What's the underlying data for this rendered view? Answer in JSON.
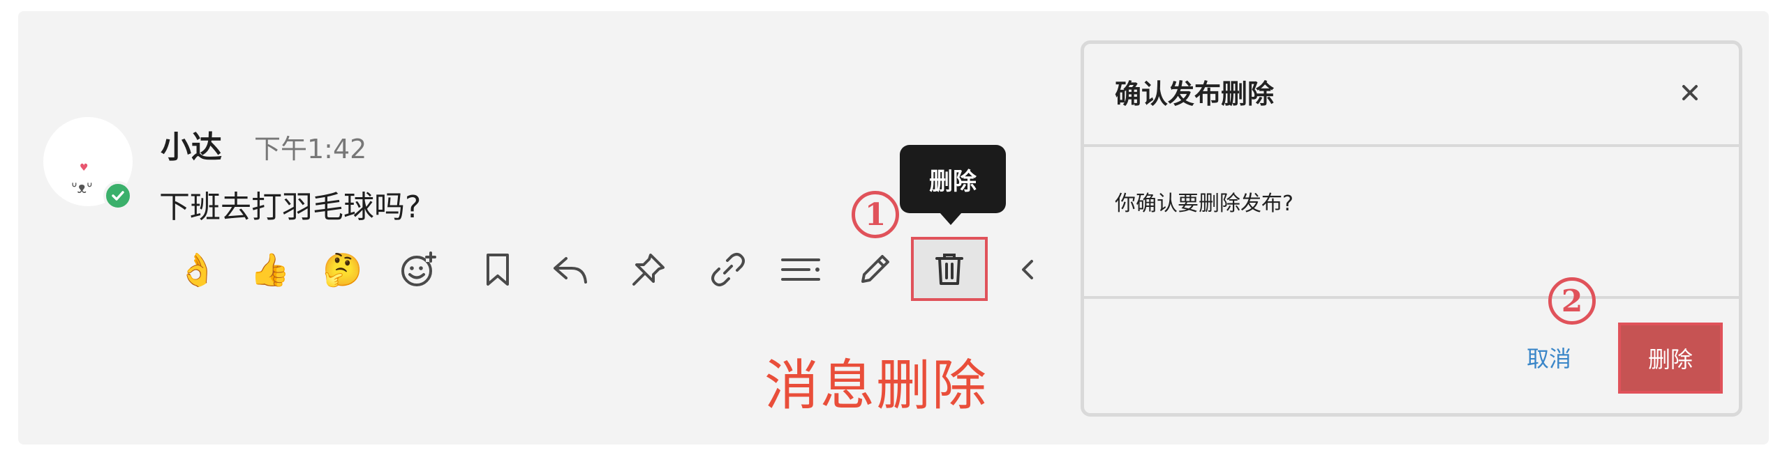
{
  "message": {
    "sender": "小达",
    "time": "下午1:42",
    "text": "下班去打羽毛球吗?"
  },
  "toolbar": {
    "reactions": [
      {
        "icon": "ok-hand-icon",
        "glyph": "👌"
      },
      {
        "icon": "thumbs-up-icon",
        "glyph": "👍"
      },
      {
        "icon": "thinking-face-icon",
        "glyph": "🤔"
      }
    ],
    "actions": [
      "add-reaction-icon",
      "bookmark-icon",
      "reply-icon",
      "pin-icon",
      "link-icon",
      "more-lines-icon",
      "edit-icon",
      "trash-icon",
      "chevron-left-icon"
    ],
    "delete_tooltip": "删除"
  },
  "annotations": {
    "step1": "1",
    "step2": "2",
    "caption": "消息删除",
    "accent_color": "#e0525a"
  },
  "dialog": {
    "title": "确认发布删除",
    "body": "你确认要删除发布?",
    "cancel_label": "取消",
    "confirm_label": "删除"
  }
}
